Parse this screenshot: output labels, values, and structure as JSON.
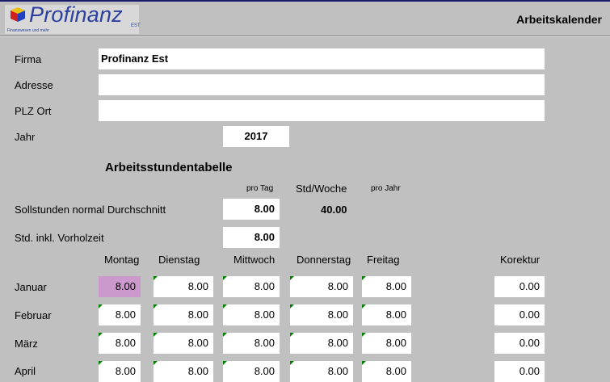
{
  "app": {
    "brand": "Profinanz",
    "brand_suffix": "EST",
    "brand_tagline": "Finanzwesen und mehr",
    "title": "Arbeitskalender"
  },
  "form": {
    "firma_label": "Firma",
    "firma_value": "Profinanz Est",
    "adresse_label": "Adresse",
    "adresse_value": "",
    "plz_label": "PLZ Ort",
    "plz_value": "",
    "jahr_label": "Jahr",
    "jahr_value": "2017"
  },
  "table": {
    "section_title": "Arbeitsstundentabelle",
    "pro_tag_header": "pro Tag",
    "std_woche_header": "Std/Woche",
    "pro_jahr_header": "pro Jahr",
    "soll_label": "Sollstunden normal Durchschnitt",
    "soll_pro_tag": "8.00",
    "soll_std_woche": "40.00",
    "vorhol_label": "Std. inkl. Vorholzeit",
    "vorhol_value": "8.00",
    "days": [
      "Montag",
      "Dienstag",
      "Mittwoch",
      "Donnerstag",
      "Freitag"
    ],
    "korrektur_header": "Korektur",
    "months": [
      {
        "name": "Januar",
        "values": [
          "8.00",
          "8.00",
          "8.00",
          "8.00",
          "8.00"
        ],
        "korrektur": "0.00"
      },
      {
        "name": "Februar",
        "values": [
          "8.00",
          "8.00",
          "8.00",
          "8.00",
          "8.00"
        ],
        "korrektur": "0.00"
      },
      {
        "name": "März",
        "values": [
          "8.00",
          "8.00",
          "8.00",
          "8.00",
          "8.00"
        ],
        "korrektur": "0.00"
      },
      {
        "name": "April",
        "values": [
          "8.00",
          "8.00",
          "8.00",
          "8.00",
          "8.00"
        ],
        "korrektur": "0.00"
      }
    ]
  },
  "colors": {
    "background": "#c0c0c0",
    "brand": "#2b3f9e",
    "highlight": "#cc99cc",
    "comment_marker": "#008000"
  }
}
